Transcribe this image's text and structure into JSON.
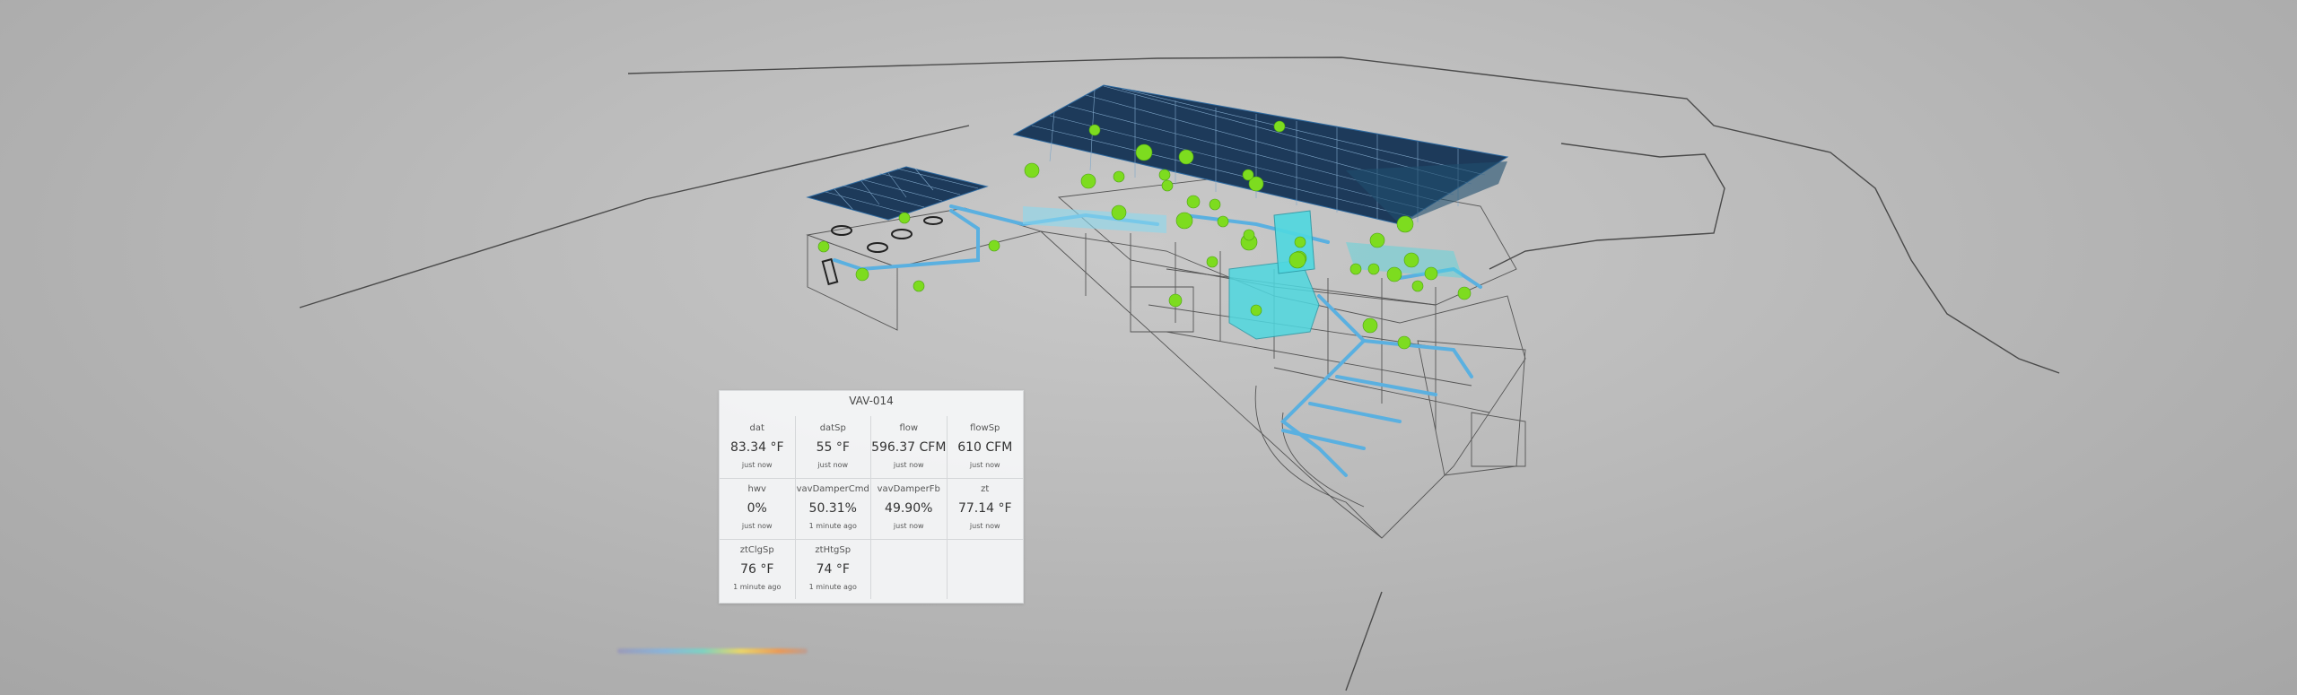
{
  "card": {
    "title": "VAV-014",
    "points": [
      {
        "name": "dat",
        "value": "83.34 °F",
        "time": "just now"
      },
      {
        "name": "datSp",
        "value": "55 °F",
        "time": "just now"
      },
      {
        "name": "flow",
        "value": "596.37 CFM",
        "time": "just now"
      },
      {
        "name": "flowSp",
        "value": "610 CFM",
        "time": "just now"
      },
      {
        "name": "hwv",
        "value": "0%",
        "time": "just now"
      },
      {
        "name": "vavDamperCmd",
        "value": "50.31%",
        "time": "1 minute ago"
      },
      {
        "name": "vavDamperFb",
        "value": "49.90%",
        "time": "just now"
      },
      {
        "name": "zt",
        "value": "77.14 °F",
        "time": "just now"
      },
      {
        "name": "ztClgSp",
        "value": "76 °F",
        "time": "1 minute ago"
      },
      {
        "name": "ztHtgSp",
        "value": "74 °F",
        "time": "1 minute ago"
      }
    ]
  },
  "colors": {
    "solar_panel": "#1d3a5a",
    "duct": "#5ab0e0",
    "equipment_cyan": "#4fd8e0",
    "sensor_marker": "#7ddc1f",
    "wireframe": "#4a4a4a"
  }
}
